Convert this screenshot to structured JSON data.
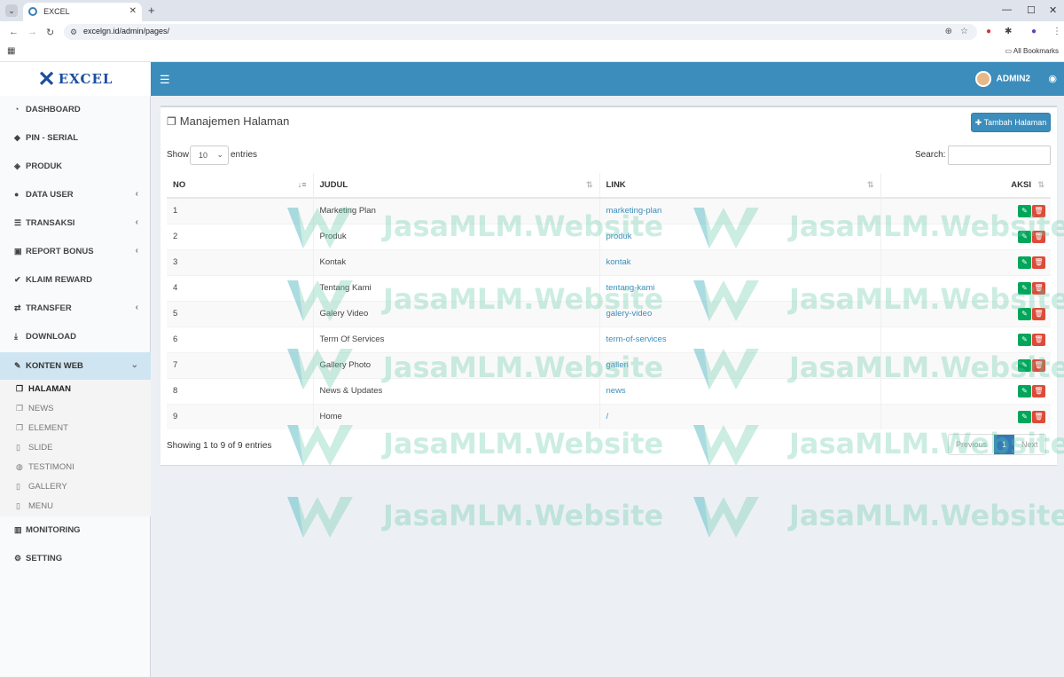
{
  "browser": {
    "tab_title": "EXCEL",
    "url": "excelgn.id/admin/pages/",
    "all_bookmarks": "All Bookmarks"
  },
  "brand": {
    "logo_text": "EXCEL",
    "color": "#1a4f9e"
  },
  "topbar": {
    "user": "ADMIN2",
    "color": "#3c8dbc"
  },
  "sidebar": {
    "items": [
      {
        "label": "DASHBOARD",
        "icon": "dashboard-icon"
      },
      {
        "label": "PIN - SERIAL",
        "icon": "tags-icon"
      },
      {
        "label": "PRODUK",
        "icon": "cube-icon"
      },
      {
        "label": "DATA USER",
        "icon": "users-icon"
      },
      {
        "label": "TRANSAKSI",
        "icon": "list-icon"
      },
      {
        "label": "REPORT BONUS",
        "icon": "money-icon"
      },
      {
        "label": "KLAIM REWARD",
        "icon": "check-icon"
      },
      {
        "label": "TRANSFER",
        "icon": "exchange-icon"
      },
      {
        "label": "DOWNLOAD",
        "icon": "download-icon"
      },
      {
        "label": "KONTEN WEB",
        "icon": "edit-icon"
      },
      {
        "label": "MONITORING",
        "icon": "bar-chart-icon"
      },
      {
        "label": "SETTING",
        "icon": "cogs-icon"
      }
    ],
    "submenu": [
      {
        "label": "HALAMAN"
      },
      {
        "label": "NEWS"
      },
      {
        "label": "ELEMENT"
      },
      {
        "label": "SLIDE"
      },
      {
        "label": "TESTIMONI"
      },
      {
        "label": "GALLERY"
      },
      {
        "label": "MENU"
      }
    ]
  },
  "panel": {
    "title": "Manajemen Halaman",
    "add_button": "Tambah Halaman",
    "show_label": "Show",
    "entries_label": "entries",
    "length_value": "10",
    "search_label": "Search:",
    "search_value": "",
    "info": "Showing 1 to 9 of 9 entries",
    "pagination": {
      "previous": "Previous",
      "page": "1",
      "next": "Next"
    }
  },
  "table": {
    "columns": [
      "NO",
      "JUDUL",
      "LINK",
      "AKSI"
    ],
    "rows": [
      {
        "no": "1",
        "judul": "Marketing Plan",
        "link": "marketing-plan"
      },
      {
        "no": "2",
        "judul": "Produk",
        "link": "produk"
      },
      {
        "no": "3",
        "judul": "Kontak",
        "link": "kontak"
      },
      {
        "no": "4",
        "judul": "Tentang Kami",
        "link": "tentang-kami"
      },
      {
        "no": "5",
        "judul": "Galery Video",
        "link": "galery-video"
      },
      {
        "no": "6",
        "judul": "Term Of Services",
        "link": "term-of-services"
      },
      {
        "no": "7",
        "judul": "Gallery Photo",
        "link": "galleri"
      },
      {
        "no": "8",
        "judul": "News & Updates",
        "link": "news"
      },
      {
        "no": "9",
        "judul": "Home",
        "link": "/"
      }
    ]
  },
  "watermark": {
    "text": "JasaMLM.Website"
  },
  "colors": {
    "edit": "#00a65a",
    "delete": "#dd4b39",
    "primary": "#3c8dbc"
  }
}
